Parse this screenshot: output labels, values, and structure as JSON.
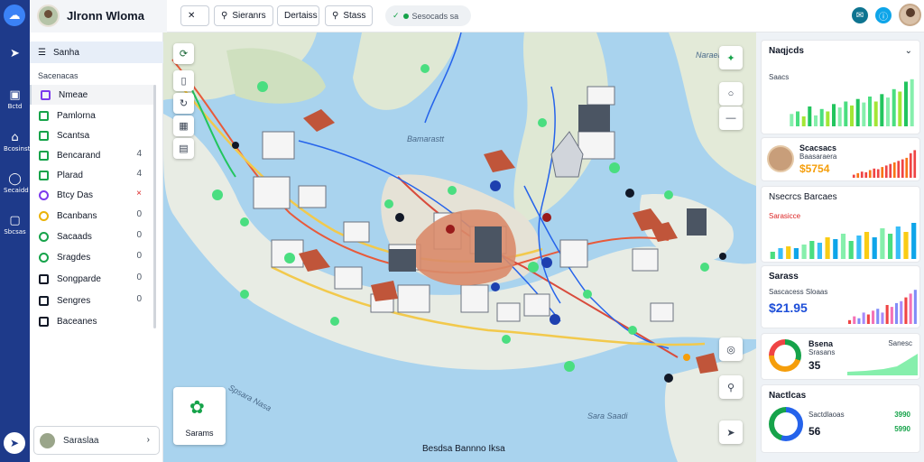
{
  "app": {
    "title": "Jlronn Wloma"
  },
  "toolbar": {
    "btn1_label": "",
    "btn2_label": "Sieranrs",
    "btn3_label": "Dertaiss",
    "btn4_label": "Stass",
    "pill_label": "Sesocads sa"
  },
  "rail": {
    "items": [
      {
        "label": "",
        "icon": "send-icon"
      },
      {
        "label": "Bctd",
        "icon": "document-icon"
      },
      {
        "label": "Bcosinst",
        "icon": "home-icon"
      },
      {
        "label": "Secaidd",
        "icon": "chat-icon"
      },
      {
        "label": "Sbcsas",
        "icon": "square-icon"
      }
    ]
  },
  "sidebar": {
    "search": "Sanha",
    "section": "Sacenacas",
    "items": [
      {
        "label": "Nmeae",
        "icon_color": "#7c3aed",
        "count": "",
        "circle": false
      },
      {
        "label": "Pamlorna",
        "icon_color": "#16a34a",
        "count": "",
        "circle": false
      },
      {
        "label": "Scantsa",
        "icon_color": "#16a34a",
        "count": "",
        "circle": false
      },
      {
        "label": "Bencarand",
        "icon_color": "#16a34a",
        "count": "4",
        "circle": false
      },
      {
        "label": "Plarad",
        "icon_color": "#16a34a",
        "count": "4",
        "circle": false
      },
      {
        "label": "Btcy Das",
        "icon_color": "#7c3aed",
        "count": "×",
        "circle": true
      },
      {
        "label": "Bcanbans",
        "icon_color": "#eab308",
        "count": "0",
        "circle": true
      },
      {
        "label": "Sacaads",
        "icon_color": "#16a34a",
        "count": "0",
        "circle": true
      },
      {
        "label": "Sragdes",
        "icon_color": "#16a34a",
        "count": "0",
        "circle": true
      },
      {
        "label": "Songparde",
        "icon_color": "#111827",
        "count": "0",
        "circle": false
      },
      {
        "label": "Sengres",
        "icon_color": "#111827",
        "count": "0",
        "circle": false
      },
      {
        "label": "Baceanes",
        "icon_color": "#111827",
        "count": "",
        "circle": false
      }
    ],
    "user_label": "Saraslaa"
  },
  "map": {
    "caption": "Besdsa Bannno Iksa",
    "card_label": "Sarams",
    "water_labels": [
      "Bamarastt",
      "Spsara Nasa",
      "Naraeae",
      "Sara Saadi"
    ]
  },
  "panel": {
    "card1": {
      "title": "Naqjcds",
      "sub": "Saacs",
      "chart": "bar",
      "heights": [
        0.25,
        0.3,
        0.2,
        0.4,
        0.22,
        0.35,
        0.3,
        0.45,
        0.38,
        0.5,
        0.42,
        0.55,
        0.48,
        0.6,
        0.5,
        0.65,
        0.58,
        0.75,
        0.7,
        0.9,
        0.95
      ]
    },
    "card2": {
      "name": "Scacsacs",
      "sub": "Baasaraera",
      "value": "$5754",
      "heights": [
        0.1,
        0.15,
        0.2,
        0.18,
        0.25,
        0.3,
        0.28,
        0.35,
        0.4,
        0.45,
        0.5,
        0.55,
        0.6,
        0.65,
        0.8,
        0.9
      ]
    },
    "card3": {
      "title": "Nsecrcs Barcaes",
      "legend": "Sarasicce",
      "heights": [
        0.2,
        0.3,
        0.35,
        0.3,
        0.4,
        0.5,
        0.45,
        0.6,
        0.55,
        0.7,
        0.5,
        0.65,
        0.75,
        0.6,
        0.85,
        0.7,
        0.9,
        0.75,
        1.0
      ]
    },
    "card4": {
      "title": "Sarass",
      "sub": "Sascacess Sloaas",
      "value": "$21.95",
      "heights": [
        0.1,
        0.2,
        0.15,
        0.3,
        0.25,
        0.35,
        0.4,
        0.3,
        0.5,
        0.45,
        0.55,
        0.6,
        0.7,
        0.8,
        0.9
      ]
    },
    "card5": {
      "title": "Bsena",
      "sub": "Srasans",
      "value": "35",
      "right": "Sanesc"
    },
    "card6": {
      "title": "Nactlcas",
      "sub": "Sactdlaoas",
      "value": "56",
      "right1": "3990",
      "right2": "5990"
    }
  }
}
